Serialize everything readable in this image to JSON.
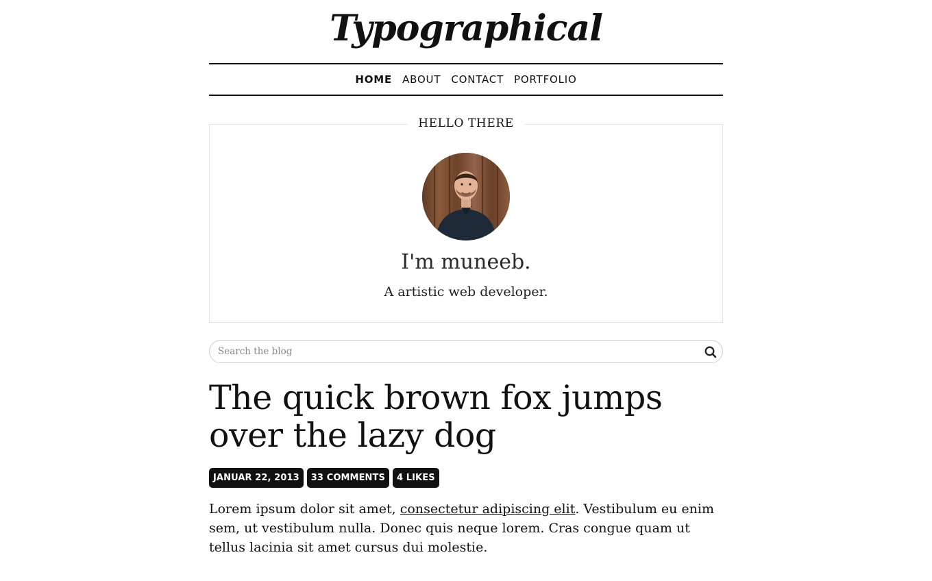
{
  "site": {
    "logo": "Typographical"
  },
  "nav": {
    "items": [
      {
        "label": "HOME",
        "active": true
      },
      {
        "label": "ABOUT",
        "active": false
      },
      {
        "label": "CONTACT",
        "active": false
      },
      {
        "label": "PORTFOLIO",
        "active": false
      }
    ]
  },
  "about": {
    "heading": "HELLO THERE",
    "name": "I'm muneeb.",
    "tagline": "A artistic web developer."
  },
  "search": {
    "placeholder": "Search the blog",
    "icon": "search-icon"
  },
  "post": {
    "title": "The quick brown fox jumps over the lazy dog",
    "meta": {
      "date": "JANUAR 22, 2013",
      "comments": "33 COMMENTS",
      "likes": "4 LIKES"
    },
    "body": {
      "before_link": "Lorem ipsum dolor sit amet, ",
      "link": "consectetur adipiscing elit",
      "after_link": ". Vestibulum eu enim sem, ut vestibulum nulla. Donec quis neque lorem. Cras congue quam ut tellus lacinia sit amet cursus dui molestie."
    }
  },
  "colors": {
    "text": "#111111",
    "badge_bg": "#111111",
    "badge_text": "#ffffff",
    "box_border": "#e2e2e2"
  }
}
